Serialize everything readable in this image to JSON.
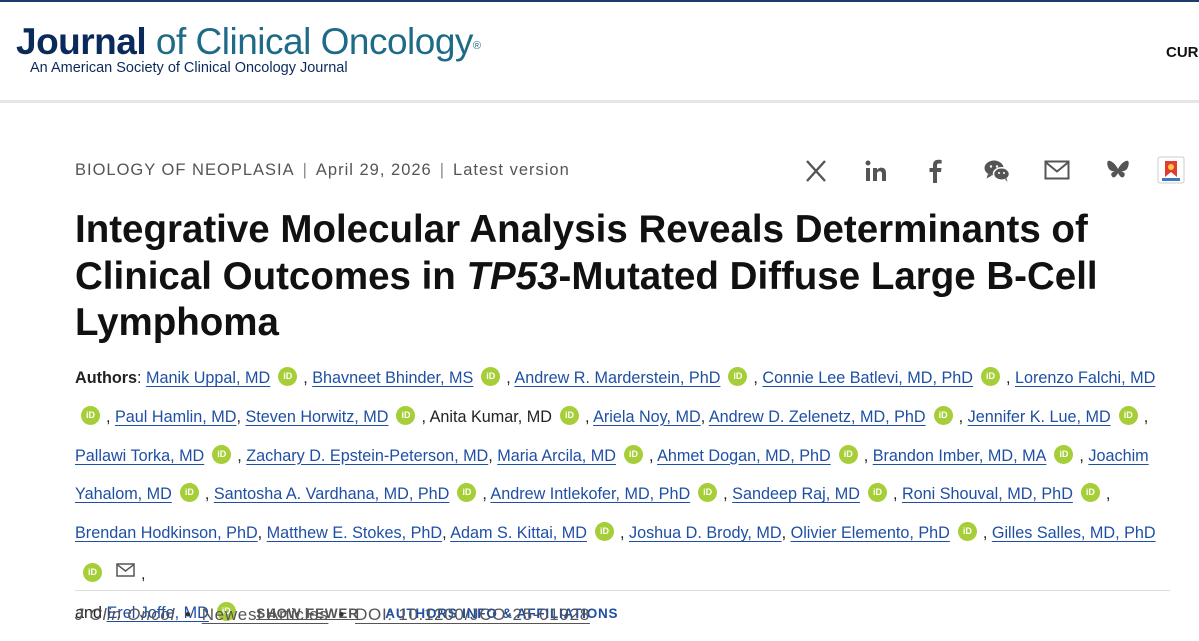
{
  "header": {
    "logo_journal": "Journal",
    "logo_rest": "of Clinical Oncology",
    "logo_reg": "®",
    "logo_subtitle": "An American Society of Clinical Oncology Journal",
    "nav_partial": "CUR"
  },
  "article_meta": {
    "section": "BIOLOGY OF NEOPLASIA",
    "sep": "|",
    "date": "April 29, 2026",
    "version": "Latest version"
  },
  "share_icons": [
    "x-icon",
    "linkedin-icon",
    "facebook-icon",
    "wechat-icon",
    "email-icon",
    "bluesky-icon",
    "bookmark-icon"
  ],
  "title": {
    "part1": "Integrative Molecular Analysis Reveals Determinants of Clinical Outcomes in ",
    "italic": "TP53",
    "part2": "-Mutated Diffuse Large B-Cell Lymphoma"
  },
  "authors": {
    "label": "Authors",
    "list": [
      "Manik Uppal, MD",
      "Bhavneet Bhinder, MS",
      "Andrew R. Marderstein, PhD",
      "Connie Lee Batlevi, MD, PhD",
      "Lorenzo Falchi, MD",
      "Paul Hamlin, MD",
      "Steven Horwitz, MD",
      "Anita Kumar, MD",
      "Ariela Noy, MD",
      "Andrew D. Zelenetz, MD, PhD",
      "Jennifer K. Lue, MD",
      "Pallawi Torka, MD",
      "Zachary D. Epstein-Peterson, MD",
      "Maria Arcila, MD",
      "Ahmet Dogan, MD, PhD",
      "Brandon Imber, MD, MA",
      "Joachim Yahalom, MD",
      "Santosha A. Vardhana, MD, PhD",
      "Andrew Intlekofer, MD, PhD",
      "Sandeep Raj, MD",
      "Roni Shouval, MD, PhD",
      "Brendan Hodkinson, PhD",
      "Matthew E. Stokes, PhD",
      "Adam S. Kittai, MD",
      "Joshua D. Brody, MD",
      "Olivier Elemento, PhD",
      "Gilles Salles, MD, PhD",
      "Erel Joffe, MD"
    ],
    "and_text": "and",
    "orcid_text": "iD",
    "show_fewer": "SHOW FEWER",
    "affiliations": "AUTHORS INFO & AFFILIATIONS"
  },
  "citation": {
    "journal": "J Clin Oncol",
    "bullet": "•",
    "section": "Newest Articles",
    "doi": "DOI: 10.1200/JCO-25-01928"
  },
  "colors": {
    "link": "#1f4fa3",
    "orcid": "#a6ce39",
    "logo_navy": "#0b2a5c",
    "logo_teal": "#1e6b87"
  }
}
